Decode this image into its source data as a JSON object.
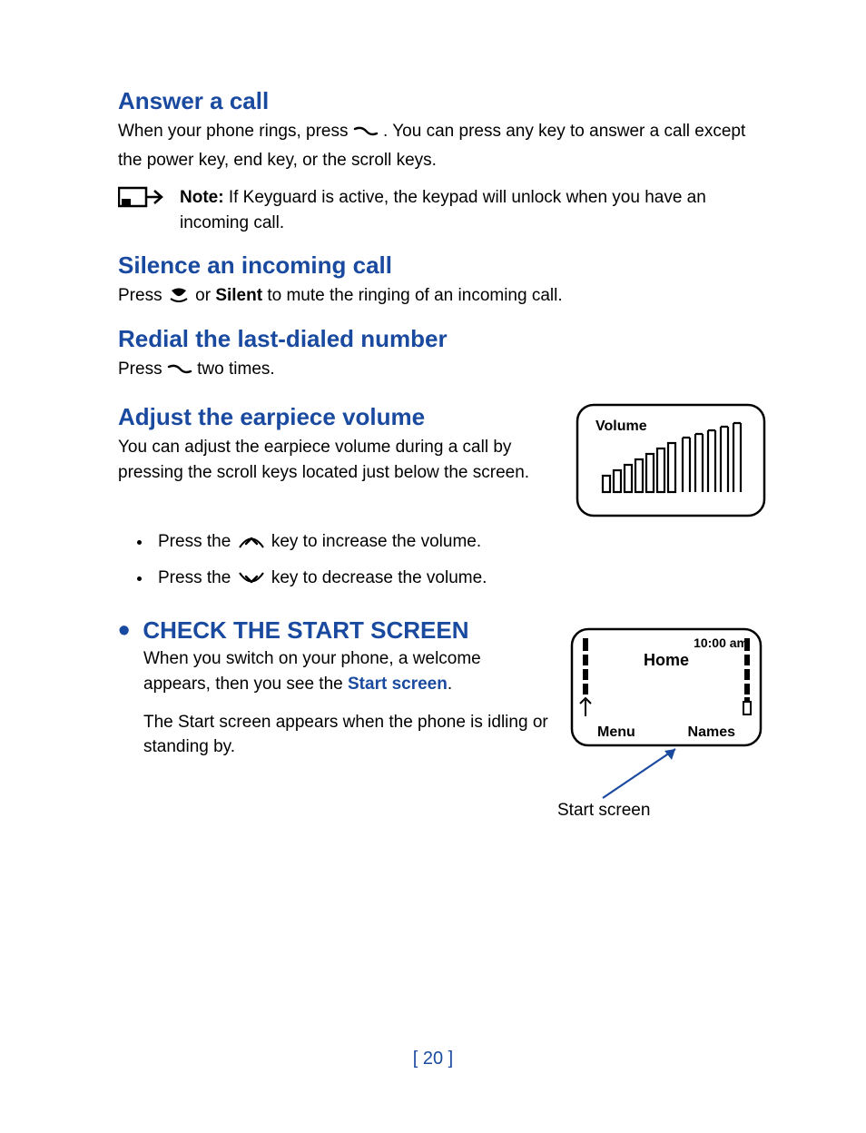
{
  "sections": {
    "answer": {
      "heading": "Answer a call",
      "body_a": "When your phone rings, press ",
      "body_b": ". You can press any key to answer a call except the power key, end key, or the scroll keys.",
      "note_label": "Note:",
      "note_text": "  If Keyguard is active, the keypad will unlock when you have an incoming call."
    },
    "silence": {
      "heading": "Silence an incoming call",
      "body_a": "Press ",
      "body_b": " or ",
      "silent": "Silent",
      "body_c": " to mute the ringing of an incoming call."
    },
    "redial": {
      "heading": "Redial the last-dialed number",
      "body_a": "Press ",
      "body_b": " two times."
    },
    "volume": {
      "heading": "Adjust the earpiece volume",
      "body": "You can adjust the earpiece volume during a call by pressing the scroll keys located just below the screen.",
      "bullet_up_a": "Press the ",
      "bullet_up_b": " key to increase the volume.",
      "bullet_down_a": "Press the ",
      "bullet_down_b": " key to decrease the volume.",
      "fig_title": "Volume"
    },
    "start": {
      "heading": "CHECK THE START SCREEN",
      "body_a": "When you switch on your phone, a welcome appears, then you see the ",
      "start_screen": "Start screen",
      "body_b": ".",
      "body2": "The Start screen appears when the phone is idling or standing by.",
      "fig_time": "10:00 am",
      "fig_home": "Home",
      "fig_menu": "Menu",
      "fig_names": "Names",
      "caption": "Start screen"
    }
  },
  "page_number": "[ 20 ]"
}
